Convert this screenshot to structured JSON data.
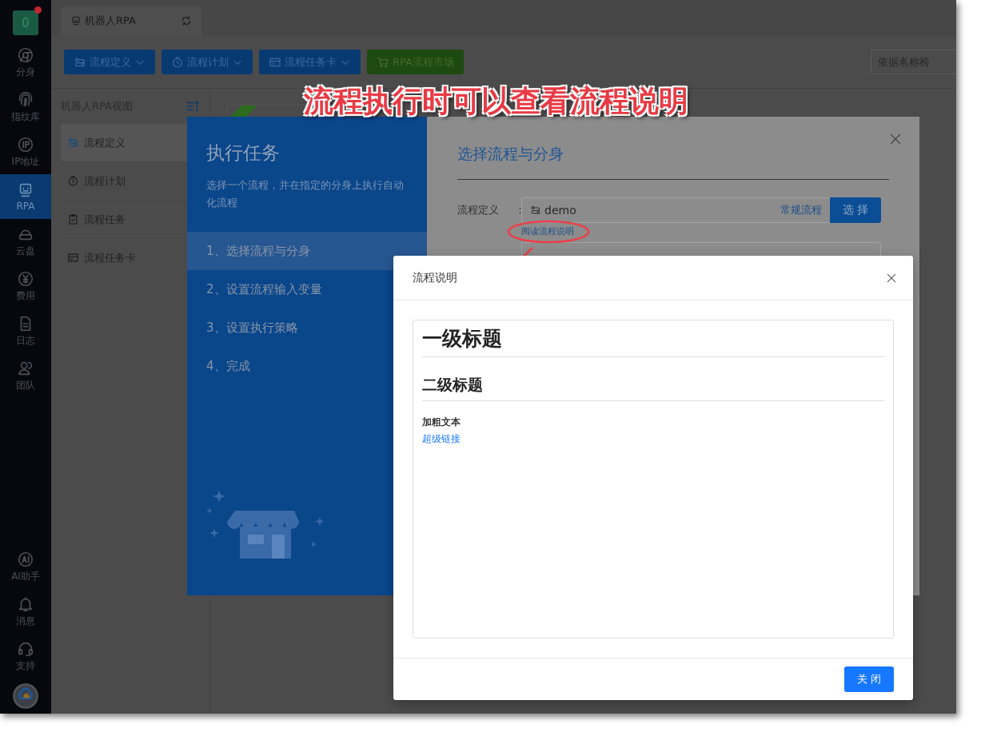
{
  "sidebar": {
    "account": {
      "label": "0",
      "has_notice": true
    },
    "items": [
      {
        "label": "分身",
        "selected": false
      },
      {
        "label": "指纹库",
        "selected": false
      },
      {
        "label": "IP地址",
        "selected": false
      },
      {
        "label": "RPA",
        "selected": true
      },
      {
        "label": "云盘",
        "selected": false
      },
      {
        "label": "费用",
        "selected": false
      },
      {
        "label": "日志",
        "selected": false
      },
      {
        "label": "团队",
        "selected": false
      }
    ],
    "bottom_items": [
      {
        "label": "AI助手"
      },
      {
        "label": "消息"
      },
      {
        "label": "支持"
      }
    ]
  },
  "tabs": [
    {
      "label": "机器人RPA"
    }
  ],
  "toolbar": {
    "buttons": [
      {
        "label": "流程定义",
        "kind": "dropdown"
      },
      {
        "label": "流程计划",
        "kind": "dropdown"
      },
      {
        "label": "流程任务卡",
        "kind": "dropdown"
      },
      {
        "label": "RPA流程市场",
        "kind": "market"
      }
    ],
    "search": {
      "placeholder": "依据名称检"
    }
  },
  "view_panel": {
    "title": "机器人RPA视图",
    "items": [
      {
        "label": "流程定义",
        "selected": true
      },
      {
        "label": "流程计划",
        "selected": false
      },
      {
        "label": "流程任务",
        "selected": false
      },
      {
        "label": "流程任务卡",
        "selected": false
      }
    ]
  },
  "annotation": {
    "text": "流程执行时可以查看流程说明"
  },
  "task_dialog": {
    "title": "执行任务",
    "description": "选择一个流程，并在指定的分身上执行自动化流程",
    "steps": [
      {
        "label": "1、选择流程与分身",
        "selected": true
      },
      {
        "label": "2、设置流程输入变量",
        "selected": false
      },
      {
        "label": "3、设置执行策略",
        "selected": false
      },
      {
        "label": "4、完成",
        "selected": false
      }
    ],
    "section_title": "选择流程与分身",
    "flow_field": {
      "label": "流程定义",
      "colon": "：",
      "value": "demo",
      "type_link": "常规流程",
      "button": "选 择",
      "read_link": "阅读流程说明"
    }
  },
  "explain_dialog": {
    "title": "流程说明",
    "heading_1": "一级标题",
    "heading_2": "二级标题",
    "bold_text": "加粗文本",
    "link": "超级链接",
    "close_button": "关 闭"
  }
}
